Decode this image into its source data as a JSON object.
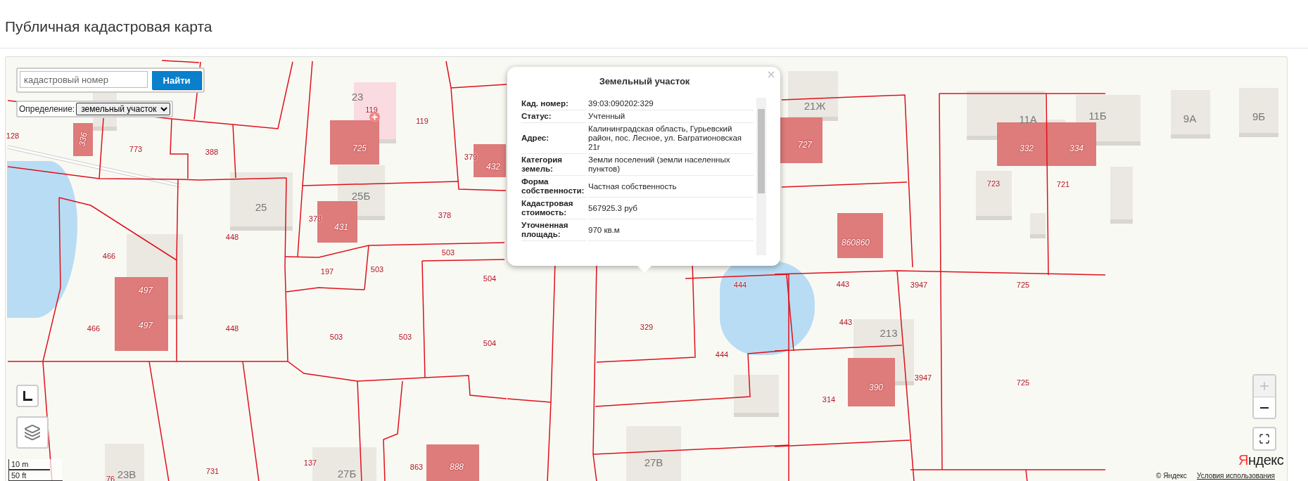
{
  "page_title": "Публичная кадастровая карта",
  "search": {
    "placeholder": "кадастровый номер",
    "button": "Найти"
  },
  "definition": {
    "label": "Определение:",
    "value": "земельный участок"
  },
  "popup": {
    "title": "Земельный участок",
    "rows": [
      {
        "label": "Кад. номер:",
        "value": "39:03:090202:329"
      },
      {
        "label": "Статус:",
        "value": "Учтенный"
      },
      {
        "label": "Адрес:",
        "value": "Калининградская область, Гурьевский район, пос. Лесное, ул. Багратионовская 21г"
      },
      {
        "label": "Категория земель:",
        "value": "Земли поселений (земли населенных пунктов)"
      },
      {
        "label": "Форма собственности:",
        "value": "Частная собственность"
      },
      {
        "label": "Кадастровая стоимость:",
        "value": "567925.3 руб"
      },
      {
        "label": "Уточненная площадь:",
        "value": "970 кв.м"
      }
    ]
  },
  "map": {
    "parcel_labels": [
      "128",
      "773",
      "388",
      "119",
      "119",
      "379",
      "448",
      "378",
      "378",
      "466",
      "466",
      "197",
      "503",
      "503",
      "503",
      "503",
      "504",
      "504",
      "448",
      "329",
      "444",
      "444",
      "443",
      "443",
      "3947",
      "3947",
      "725",
      "725",
      "723",
      "721",
      "314",
      "731",
      "137",
      "863",
      "76"
    ],
    "buildings": [
      {
        "label": "23",
        "kind": "marked"
      },
      {
        "label": "25",
        "kind": "house"
      },
      {
        "label": "25Б",
        "kind": "house"
      },
      {
        "label": "21Ж",
        "kind": "house"
      },
      {
        "label": "11А",
        "kind": "house"
      },
      {
        "label": "11Б",
        "kind": "house"
      },
      {
        "label": "9А",
        "kind": "house"
      },
      {
        "label": "9Б",
        "kind": "house"
      },
      {
        "label": "213",
        "kind": "house"
      },
      {
        "label": "23В",
        "kind": "house"
      },
      {
        "label": "27Б",
        "kind": "house"
      },
      {
        "label": "27В",
        "kind": "house"
      }
    ],
    "cadastral_objects": [
      {
        "labels": [
          "336"
        ]
      },
      {
        "labels": [
          "725"
        ]
      },
      {
        "labels": [
          "432"
        ]
      },
      {
        "labels": [
          "431"
        ]
      },
      {
        "labels": [
          "497",
          "497"
        ]
      },
      {
        "labels": [
          "727"
        ]
      },
      {
        "labels": [
          "332",
          "334"
        ]
      },
      {
        "labels": [
          "860860"
        ]
      },
      {
        "labels": [
          "390"
        ]
      },
      {
        "labels": [
          "888"
        ]
      }
    ]
  },
  "scale": {
    "metric": "10 m",
    "imperial": "50 ft"
  },
  "zoom": {
    "zoom_in_disabled": true
  },
  "attribution": {
    "logo": "Яндекс",
    "copyright": "© Яндекс",
    "terms": "Условия использования"
  }
}
